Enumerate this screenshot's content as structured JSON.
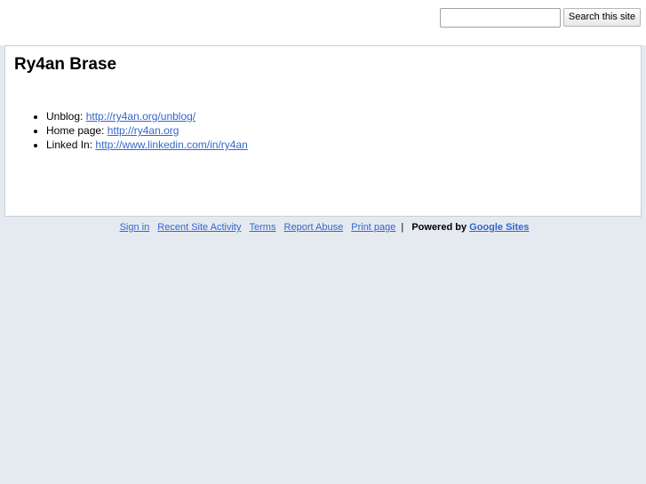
{
  "search": {
    "placeholder": "",
    "value": "",
    "button_label": "Search this site"
  },
  "page": {
    "title": "Ry4an Brase"
  },
  "links": [
    {
      "label": "Unblog:",
      "url_text": "http://ry4an.org/unblog/"
    },
    {
      "label": "Home page:",
      "url_text": "http://ry4an.org"
    },
    {
      "label": "Linked In:",
      "url_text": "http://www.linkedin.com/in/ry4an"
    }
  ],
  "footer": {
    "sign_in": "Sign in",
    "recent_activity": "Recent Site Activity",
    "terms": "Terms",
    "report_abuse": "Report Abuse",
    "print_page": "Print page",
    "separator": "|",
    "powered_by": "Powered by",
    "google_sites": "Google Sites"
  },
  "colors": {
    "background": "#e5e9f0",
    "link": "#3366cc",
    "panel": "#ffffff"
  }
}
